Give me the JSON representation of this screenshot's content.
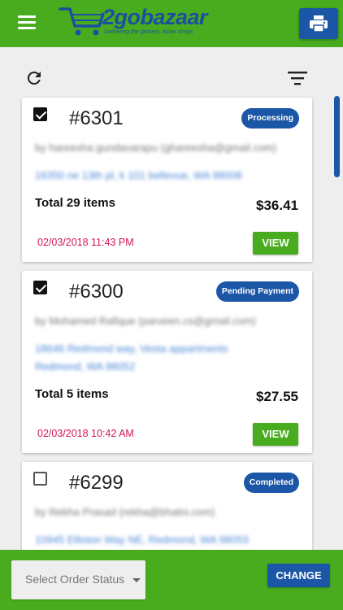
{
  "header": {
    "logo_title": "2gobazaar",
    "logo_tagline": "Delivering the grocery, Asian shops",
    "menu_icon": "hamburger-icon",
    "print_icon": "printer-icon"
  },
  "toolbar": {
    "refresh_icon": "refresh-icon",
    "filter_icon": "filter-icon"
  },
  "orders": [
    {
      "number": "#6301",
      "checked": true,
      "status": "Processing",
      "customer": "by hareesha gundavarapu (ghareesha@gmail.com)",
      "address": "16350 ne 13th pl, k 101 bellevue, WA 98008",
      "total": "Total 29 items",
      "price": "$36.41",
      "date": "02/03/2018 11:43 PM",
      "view_label": "VIEW"
    },
    {
      "number": "#6300",
      "checked": true,
      "status": "Pending Payment",
      "customer": "by Mohamed Rafique (parveen.cs@gmail.com)",
      "address": "18646 Redmond way, Vesta appartments Redmond, WA 98052",
      "total": "Total 5 items",
      "price": "$27.55",
      "date": "02/03/2018 10:42 AM",
      "view_label": "VIEW"
    },
    {
      "number": "#6299",
      "checked": false,
      "status": "Completed",
      "customer": "by Rekha Prasad (rekha@bhatni.com)",
      "address": "10945 Elliston Way NE, Redmond, WA 98053"
    }
  ],
  "footer": {
    "select_placeholder": "Select Order Status",
    "change_label": "CHANGE"
  },
  "colors": {
    "brand_green": "#49ac1f",
    "brand_blue": "#1c56a6",
    "date_red": "#d4145a"
  }
}
